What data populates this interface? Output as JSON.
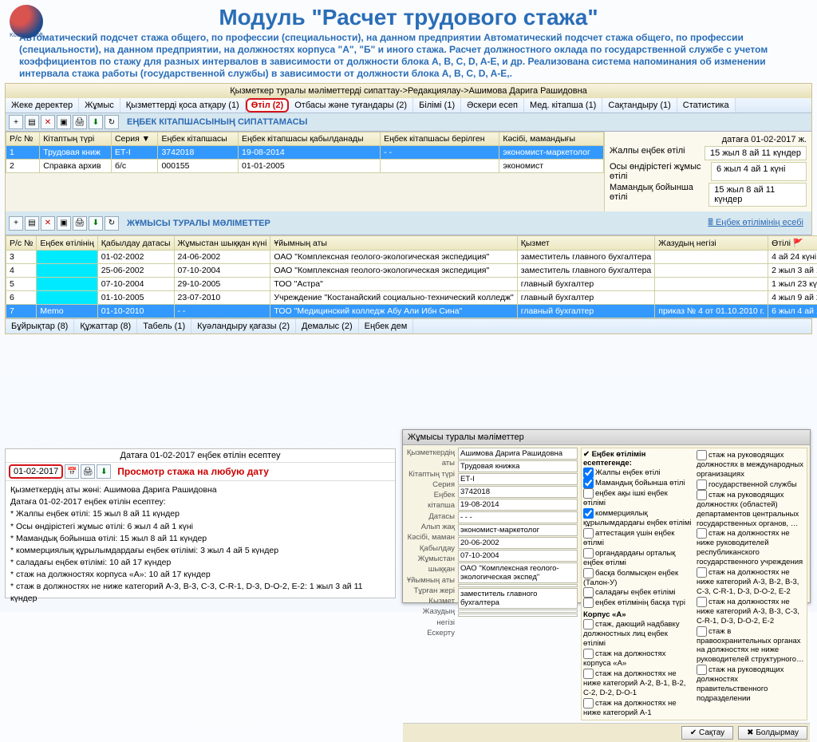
{
  "slide": {
    "title": "Модуль \"Расчет трудового стажа\"",
    "desc": "Автоматический подсчет стажа общего, по профессии (специальности), на данном предприятии Автоматический подсчет стажа общего, по профессии (специальности), на данном предприятии, на должностях корпуса \"А\", \"Б\" и иного стажа. Расчет должностного оклада по государственной службе с учетом коэффициентов по стажу для разных интервалов в зависимости от должности блока A, B, C, D, A-E, и др. Реализована система напоминания об изменении интервала стажа работы (государственной службы) в зависимости от должности блока A, B, C, D, A-E,."
  },
  "app": {
    "title": "Қызметкер туралы мәліметтерді сипаттау->Редакциялау->Ашимова Дарига Рашидовна",
    "tabs": [
      "Жеке деректер",
      "Жұмыс",
      "Қызметтерді қоса атқару (1)",
      "Өтіл (2)",
      "Отбасы және туғандары (2)",
      "Білімі (1)",
      "Әскери есеп",
      "Мед. кітапша (1)",
      "Сақтандыру (1)",
      "Статистика"
    ],
    "active_tab_index": 3,
    "section1_label": "ЕҢБЕК КІТАПШАСЫНЫҢ СИПАТТАМАСЫ",
    "section2_label": "ЖҰМЫСЫ ТУРАЛЫ МӘЛІМЕТТЕР",
    "calc_link": "Еңбек өтілімінің есебі"
  },
  "table1": {
    "headers": [
      "Р/с №",
      "Кітаптың түрі",
      "Серия ▼",
      "Еңбек кітапшасы",
      "Еңбек кітапшасы қабылданады",
      "Еңбек кітапшасы берілген",
      "Кәсібі, мамандығы"
    ],
    "rows": [
      {
        "n": "1",
        "type": "Трудовая книж",
        "ser": "ЕТ-І",
        "nbr": "3742018",
        "d1": "19-08-2014",
        "d2": "- -",
        "prof": "экономист-маркетолог"
      },
      {
        "n": "2",
        "type": "Справка архив",
        "ser": "б/с",
        "nbr": "000155",
        "d1": "01-01-2005",
        "d2": "",
        "prof": "экономист"
      }
    ]
  },
  "sidebar": {
    "date_as_of": "датаға 01-02-2017 ж.",
    "total_label": "Жалпы еңбек өтілі",
    "total_val": "15 жыл 8 ай 11 күндер",
    "here_label": "Осы өндірістегі жұмыс өтілі",
    "here_val": "6 жыл 4 ай 1 күні",
    "prof_label": "Мамандық бойынша өтілі",
    "prof_val": "15 жыл 8 ай 11 күндер"
  },
  "table2": {
    "headers": [
      "Р/с №",
      "Еңбек өтілінің",
      "Қабылдау датасы",
      "Жұмыстан шыққан күні",
      "Ұйымның аты",
      "Қызмет",
      "Жазудың негізі",
      "Өтілі 🚩"
    ],
    "rows": [
      {
        "n": "3",
        "c": "",
        "d1": "01-02-2002",
        "d2": "24-06-2002",
        "org": "ОАО \"Комплексная геолого-экологическая экспедиция\"",
        "pos": "заместитель главного бухгалтера",
        "base": "",
        "exp": "4 ай 24 күні"
      },
      {
        "n": "4",
        "c": "",
        "d1": "25-06-2002",
        "d2": "07-10-2004",
        "org": "ОАО \"Комплексная геолого-экологическая экспедиция\"",
        "pos": "заместитель главного бухгалтера",
        "base": "",
        "exp": "2 жыл 3 ай 13 күндер"
      },
      {
        "n": "5",
        "c": "",
        "d1": "07-10-2004",
        "d2": "29-10-2005",
        "org": "ТОО \"Астра\"",
        "pos": "главный бухгалтер",
        "base": "",
        "exp": "1 жыл 23 күні"
      },
      {
        "n": "6",
        "c": "",
        "d1": "01-10-2005",
        "d2": "23-07-2010",
        "org": "Учреждение \"Костанайский социально-технический колледж\"",
        "pos": "главный бухгалтер",
        "base": "",
        "exp": "4 жыл 9 ай 23 күні"
      },
      {
        "n": "7",
        "c": "Memo",
        "d1": "01-10-2010",
        "d2": "- -",
        "org": "ТОО \"Медицинский колледж Абу Али Ибн Сина\"",
        "pos": "главный бухгалтер",
        "base": "приказ № 4 от 01.10.2010 г.",
        "exp": "6 жыл 4 ай 1 күні",
        "sel": true
      }
    ]
  },
  "bottom_tabs": [
    "Бұйрықтар (8)",
    "Құжаттар (8)",
    "Табель (1)",
    "Куәландыру қағазы (2)",
    "Демалыс (2)",
    "Еңбек дем"
  ],
  "overlay_left": {
    "title": "Датаға 01-02-2017 еңбек өтілін есептеу",
    "date": "01-02-2017",
    "highlight": "Просмотр стажа на любую дату",
    "lines": [
      "Қызметкердің аты жөні: Ашимова Дарига Рашидовна",
      "Датаға 01-02-2017 еңбек өтілін есептеу:",
      "* Жалпы еңбек өтілі: 15 жыл 8 ай 11 күндер",
      "* Осы өндірістегі жұмыс өтілі: 6 жыл 4 ай 1 күні",
      "* Мамандық бойынша өтілі: 15 жыл 8 ай 11 күндер",
      "* коммерциялық құрылымдардағы еңбек өтілімі: 3 жыл 4 ай 5 күндер",
      "* саладағы еңбек өтілімі: 10 ай 17 күндер",
      "* стаж на должностях корпуса «А»: 10 ай 17 күндер",
      "* стаж в должностях не ниже категорий A-3, B-3, C-3, C-R-1, D-3, D-O-2, E-2: 1 жыл 3 ай 11 күндер"
    ]
  },
  "overlay_right": {
    "title": "Жұмысы туралы мәліметтер",
    "labels": [
      "Қызметкердің аты",
      "Кітаптың түрі",
      "Серия",
      "Еңбек кітапша",
      "Датасы",
      "Алып жақ",
      "Кәсібі, маман",
      "Қабылдау",
      "Жұмыстан шыққан",
      "Ұйымның аты",
      "Тұрған жері",
      "Кызмет",
      "Жазудың негізі",
      "Ескерту"
    ],
    "fields": [
      "Ашимова Дарига Рашидовна",
      "Трудовая книжка",
      "ЕТ-І",
      "3742018",
      "19-08-2014",
      "- - -",
      "экономист-маркетолог",
      "20-06-2002",
      "07-10-2004",
      "ОАО \"Комплексная геолого-экологическая экспед\"",
      "",
      "заместитель главного бухгалтера",
      "",
      ""
    ],
    "chk_header1": "Еңбек өтілімін есептегенде:",
    "chk_left": [
      {
        "c": true,
        "t": "Жалпы еңбек өтілі"
      },
      {
        "c": true,
        "t": "Мамандық бойынша өтілі"
      },
      {
        "c": false,
        "t": "еңбек ақы ішкі еңбек өтілімі"
      },
      {
        "c": true,
        "t": "коммерциялық құрылымдардағы еңбек өтілімі"
      }
    ],
    "chk_right_top": [
      {
        "c": false,
        "t": "аттестация үшін еңбек өтілмі"
      },
      {
        "c": false,
        "t": "органдардағы орталық еңбек өтілмі"
      },
      {
        "c": false,
        "t": "басқа болмысқен еңбек (Талон-У)"
      },
      {
        "c": false,
        "t": "саладағы еңбек өтілімі"
      },
      {
        "c": false,
        "t": "еңбек өтілмінің басқа түрі"
      }
    ],
    "chk_corpus_label": "Корпус «А»",
    "chk_corpus": [
      {
        "c": false,
        "t": "стаж, дающий надбавку должностных лиц еңбек өтілімі"
      },
      {
        "c": false,
        "t": "стаж на должностях корпуса «А»"
      },
      {
        "c": false,
        "t": "стаж на должностях не ниже категорий А-2, В-1, В-2, С-2, D-2, D-O-1"
      },
      {
        "c": false,
        "t": "стаж на должностях не ниже категорий А-1"
      },
      {
        "c": false,
        "t": "стаж на руководящих должностях в международных организациях"
      },
      {
        "c": false,
        "t": "государственной службы"
      },
      {
        "c": false,
        "t": "стаж на руководящих должностях (областей) департаментов центральных государственных органов, …"
      },
      {
        "c": false,
        "t": "стаж на должностях не ниже руководителей республиканского государственного учреждения"
      },
      {
        "c": false,
        "t": "стаж на должностях не ниже категорий А-3, В-2, В-3, С-3, C-R-1, D-3, D-O-2, E-2"
      },
      {
        "c": false,
        "t": "стаж на должностях не ниже категорий А-3, В-3, С-3, C-R-1, D-3, D-O-2, E-2"
      },
      {
        "c": false,
        "t": "стаж в правоохранительных органах на должностях не ниже руководителей структурного…"
      },
      {
        "c": false,
        "t": "стаж на руководящих должностях правительственного подразделении"
      }
    ],
    "btn_save": "Сақтау",
    "btn_cancel": "Болдырмау"
  }
}
